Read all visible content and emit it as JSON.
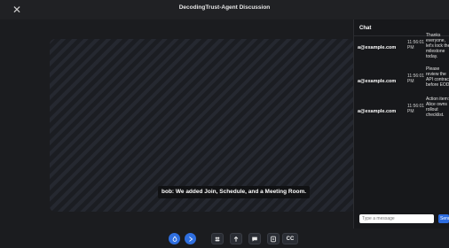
{
  "window": {
    "title": "DecodingTrust-Agent Discussion",
    "close_symbol": "✕"
  },
  "caption": {
    "text": "bob: We added Join, Schedule, and a Meeting Room."
  },
  "chat": {
    "header": "Chat",
    "messages": [
      {
        "sender": "a@example.com",
        "time": "11:56:01 PM",
        "text": "Thanks everyone, let's lock the milestone today."
      },
      {
        "sender": "a@example.com",
        "time": "11:56:01 PM",
        "text": "Please review the API contract before EOD."
      },
      {
        "sender": "a@example.com",
        "time": "11:56:01 PM",
        "text": "Action item: Alice owns rollout checklist."
      }
    ],
    "input_placeholder": "Type a message",
    "send_label": "Send"
  },
  "toolbar": {
    "items": [
      {
        "name": "mic-button",
        "icon": "mic-icon",
        "style": "circle"
      },
      {
        "name": "camera-button",
        "icon": "camera-icon",
        "style": "circle"
      },
      {
        "name": "participants-button",
        "icon": "participants-icon",
        "style": "square"
      },
      {
        "name": "share-screen-button",
        "icon": "share-icon",
        "style": "square"
      },
      {
        "name": "chat-button",
        "icon": "chat-bubble-icon",
        "style": "square"
      },
      {
        "name": "notes-button",
        "icon": "notes-icon",
        "style": "square"
      }
    ],
    "cc_label": "CC"
  },
  "colors": {
    "accent": "#2f6fe0",
    "background": "#1b1c1f",
    "panel": "#17181b",
    "send": "#2d6cdf"
  }
}
